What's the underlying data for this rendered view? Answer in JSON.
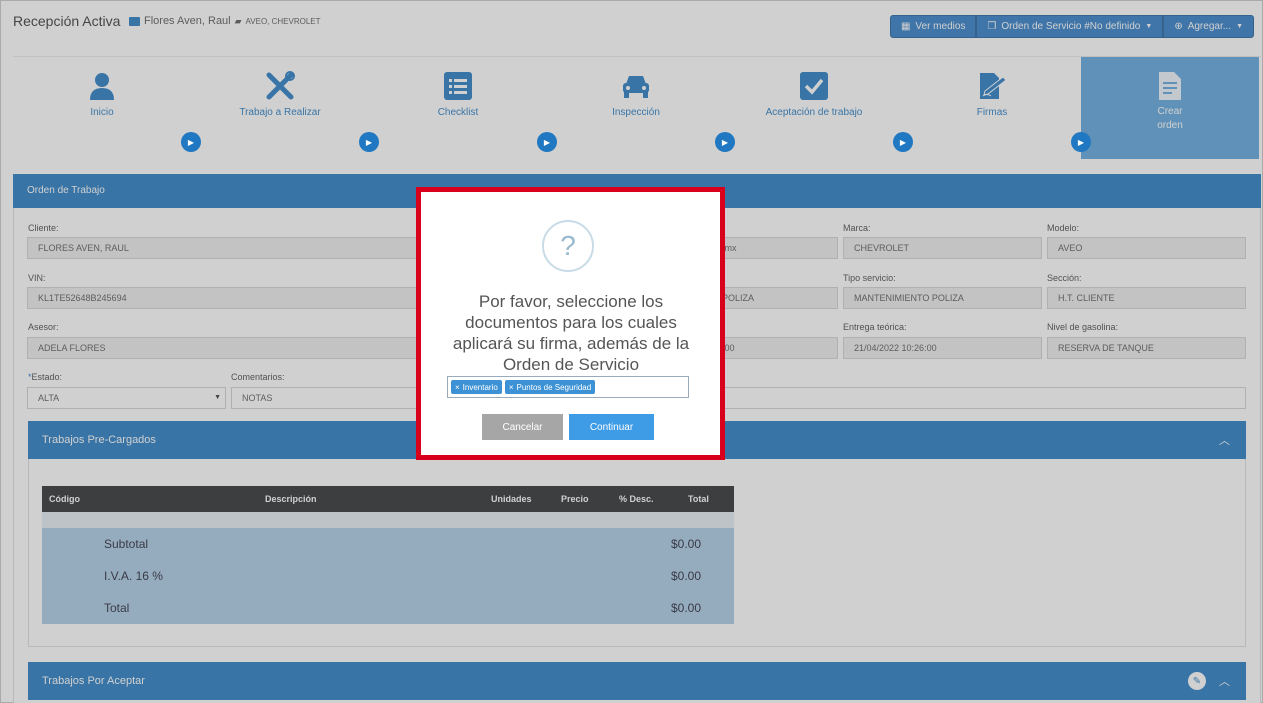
{
  "header": {
    "title": "Recepción Activa",
    "client_name": "Flores Aven, Raul",
    "vehicle": "AVEO, CHEVROLET",
    "buttons": [
      {
        "label": "Ver medios"
      },
      {
        "label": "Orden de Servicio #No definido"
      },
      {
        "label": "Agregar..."
      }
    ]
  },
  "steps": [
    {
      "label": "Inicio",
      "icon": "user-icon"
    },
    {
      "label": "Trabajo a Realizar",
      "icon": "tools-icon"
    },
    {
      "label": "Checklist",
      "icon": "list-icon"
    },
    {
      "label": "Inspección",
      "icon": "car-icon"
    },
    {
      "label": "Aceptación de trabajo",
      "icon": "check-square-icon"
    },
    {
      "label": "Firmas",
      "icon": "signature-icon"
    },
    {
      "label": "Crear orden",
      "icon": "document-icon"
    }
  ],
  "panel": {
    "title": "Orden de Trabajo",
    "fields": {
      "cliente": {
        "label": "Cliente:",
        "value": "FLORES AVEN, RAUL"
      },
      "email_partial": {
        "value": ".mx"
      },
      "marca": {
        "label": "Marca:",
        "value": "CHEVROLET"
      },
      "modelo": {
        "label": "Modelo:",
        "value": "AVEO"
      },
      "vin": {
        "label": "VIN:",
        "value": "KL1TE52648B245694"
      },
      "tipo_partial": {
        "value": "POLIZA"
      },
      "tipo_servicio": {
        "label": "Tipo servicio:",
        "value": "MANTENIMIENTO POLIZA"
      },
      "seccion": {
        "label": "Sección:",
        "value": "H.T. CLIENTE"
      },
      "asesor": {
        "label": "Asesor:",
        "value": "ADELA FLORES"
      },
      "hora_partial": {
        "value": ":00"
      },
      "entrega": {
        "label": "Entrega teórica:",
        "value": "21/04/2022 10:26:00"
      },
      "gasolina": {
        "label": "Nivel de gasolina:",
        "value": "RESERVA DE TANQUE"
      },
      "estado": {
        "label": "Estado:",
        "required_mark": "*",
        "value": "ALTA"
      },
      "comentarios": {
        "label": "Comentarios:",
        "value": "NOTAS"
      }
    }
  },
  "precargados": {
    "title": "Trabajos Pre-Cargados",
    "columns": [
      "Código",
      "Descripción",
      "Unidades",
      "Precio",
      "% Desc.",
      "Total"
    ],
    "summary": [
      {
        "label": "Subtotal",
        "value": "$0.00"
      },
      {
        "label": "I.V.A. 16 %",
        "value": "$0.00"
      },
      {
        "label": "Total",
        "value": "$0.00"
      }
    ]
  },
  "por_aceptar": {
    "title": "Trabajos Por Aceptar"
  },
  "modal": {
    "icon": "?",
    "message": "Por favor, seleccione los documentos para los cuales aplicará su firma, además de la Orden de Servicio",
    "tags": [
      "Inventario",
      "Puntos de Seguridad"
    ],
    "cancel_label": "Cancelar",
    "ok_label": "Continuar"
  },
  "colors": {
    "primary": "#1f78c1",
    "highlight": "#d9001b",
    "step_active": "#5ba4dd"
  }
}
